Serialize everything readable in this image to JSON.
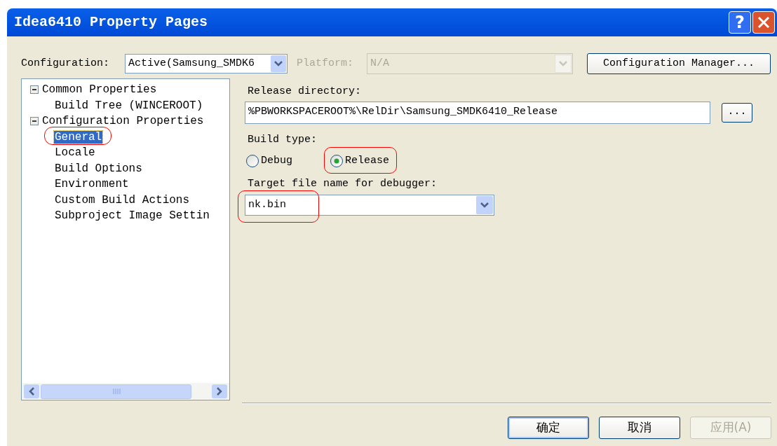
{
  "window": {
    "title": "Idea6410 Property Pages"
  },
  "title_buttons": [
    {
      "kind": "help",
      "label": "?"
    },
    {
      "kind": "close"
    }
  ],
  "configuration": {
    "label": "Configuration:",
    "value": "Active(Samsung_SMDK6"
  },
  "platform": {
    "label": "Platform:",
    "value": "N/A",
    "disabled": true
  },
  "configuration_manager_button": "Configuration Manager...",
  "tree": [
    {
      "label": "Common Properties",
      "expanded": true,
      "selected": false,
      "circled": false,
      "children": [
        {
          "label": "Build Tree (WINCEROOT)",
          "selected": false,
          "circled": false
        }
      ]
    },
    {
      "label": "Configuration Properties",
      "expanded": true,
      "selected": false,
      "circled": false,
      "children": [
        {
          "label": "General",
          "selected": true,
          "circled": true
        },
        {
          "label": "Locale",
          "selected": false,
          "circled": false
        },
        {
          "label": "Build Options",
          "selected": false,
          "circled": false
        },
        {
          "label": "Environment",
          "selected": false,
          "circled": false
        },
        {
          "label": "Custom Build Actions",
          "selected": false,
          "circled": false
        },
        {
          "label": "Subproject Image Settin",
          "selected": false,
          "circled": false
        }
      ]
    }
  ],
  "release_directory": {
    "label": "Release directory:",
    "value": "%PBWORKSPACEROOT%\\RelDir\\Samsung_SMDK6410_Release",
    "browse": "..."
  },
  "build_type": {
    "label": "Build type:",
    "options": [
      {
        "label": "Debug",
        "selected": false,
        "circled": false
      },
      {
        "label": "Release",
        "selected": true,
        "circled": true
      }
    ]
  },
  "target_file": {
    "label": "Target file name for debugger:",
    "value": "nk.bin",
    "circled": true
  },
  "buttons": [
    {
      "label": "确定",
      "disabled": false,
      "default": true
    },
    {
      "label": "取消",
      "disabled": false,
      "default": false
    },
    {
      "label": "应用(A)",
      "disabled": true,
      "default": false
    }
  ]
}
